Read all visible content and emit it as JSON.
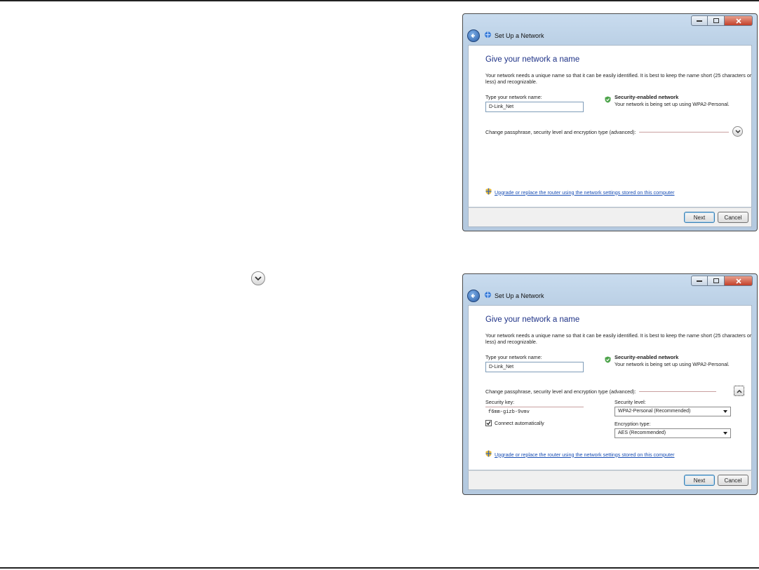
{
  "windows": [
    {
      "title": "Set Up a Network",
      "heading": "Give your network a name",
      "description": "Your network needs a unique name so that it can be easily identified. It is best to keep the name short (25 characters or less) and recognizable.",
      "name_label": "Type your network name:",
      "name_value": "D-Link_Net",
      "security_title": "Security-enabled network",
      "security_sub": "Your network is being set up using WPA2-Personal.",
      "advanced_label": "Change passphrase, security level and encryption type (advanced):",
      "link_text": "Upgrade or replace the router using the network settings stored on this computer",
      "next_label": "Next",
      "cancel_label": "Cancel"
    },
    {
      "title": "Set Up a Network",
      "heading": "Give your network a name",
      "description": "Your network needs a unique name so that it can be easily identified. It is best to keep the name short (25 characters or less) and recognizable.",
      "name_label": "Type your network name:",
      "name_value": "D-Link_Net",
      "security_title": "Security-enabled network",
      "security_sub": "Your network is being set up using WPA2-Personal.",
      "advanced_label": "Change passphrase, security level and encryption type (advanced):",
      "security_key_label": "Security key:",
      "security_key_value": "f6mm-gizb-9vmv",
      "security_level_label": "Security level:",
      "security_level_value": "WPA2-Personal (Recommended)",
      "connect_auto_label": "Connect automatically",
      "connect_auto_checked": true,
      "encryption_label": "Encryption type:",
      "encryption_value": "AES (Recommended)",
      "link_text": "Upgrade or replace the router using the network settings stored on this computer",
      "next_label": "Next",
      "cancel_label": "Cancel"
    }
  ],
  "colors": {
    "heading": "#1e3287",
    "link": "#1a4fb5",
    "close_button": "#c3402a"
  },
  "icons": {
    "expand": "chevron-down-icon",
    "collapse": "chevron-up-icon",
    "back": "back-arrow-icon",
    "network": "network-icon",
    "shield": "shield-check-icon",
    "uac": "uac-shield-icon"
  }
}
